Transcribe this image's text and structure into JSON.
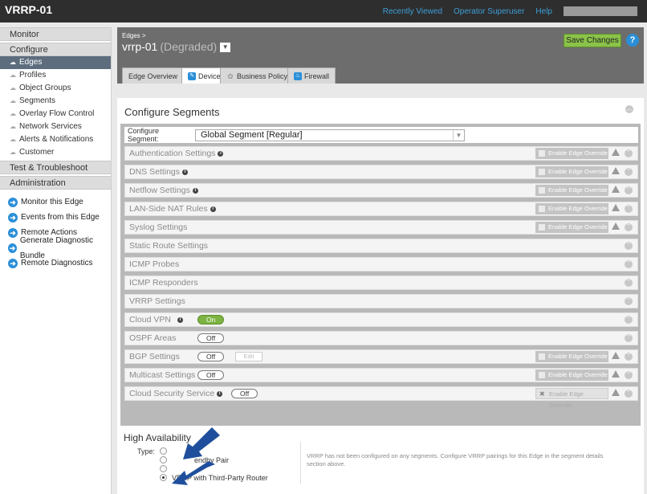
{
  "app": {
    "title": "VRRP-01",
    "links": [
      "Recently Viewed",
      "Operator Superuser",
      "Help"
    ]
  },
  "sidebar": {
    "monitor": "Monitor",
    "configure": "Configure",
    "config_items": [
      {
        "label": "Edges",
        "active": true
      },
      {
        "label": "Profiles"
      },
      {
        "label": "Object Groups"
      },
      {
        "label": "Segments"
      },
      {
        "label": "Overlay Flow Control"
      },
      {
        "label": "Network Services"
      },
      {
        "label": "Alerts & Notifications"
      },
      {
        "label": "Customer"
      }
    ],
    "test": "Test & Troubleshoot",
    "administration": "Administration",
    "actions": [
      "Monitor this Edge",
      "Events from this Edge",
      "Remote Actions",
      "Generate Diagnostic Bundle",
      "Remote Diagnostics"
    ]
  },
  "header": {
    "breadcrumb": "Edges",
    "edge_name": "vrrp-01",
    "status": "(Degraded)",
    "save_label": "Save Changes",
    "help_glyph": "?"
  },
  "tabs": [
    {
      "label": "Edge Overview"
    },
    {
      "label": "Device",
      "active": true
    },
    {
      "label": "Business Policy"
    },
    {
      "label": "Firewall"
    }
  ],
  "configure_segments": {
    "title": "Configure Segments",
    "segment_label": "Configure Segment:",
    "segment_value": "Global Segment [Regular]",
    "override_label": "Enable Edge Override",
    "sections": [
      {
        "label": "Authentication Settings",
        "info": true,
        "override": true
      },
      {
        "label": "DNS Settings",
        "info": true,
        "override": true
      },
      {
        "label": "Netflow Settings",
        "info": true,
        "override": true
      },
      {
        "label": "LAN-Side NAT Rules",
        "info": true,
        "override": true
      },
      {
        "label": "Syslog Settings",
        "override": true
      },
      {
        "label": "Static Route Settings"
      },
      {
        "label": "ICMP Probes"
      },
      {
        "label": "ICMP Responders"
      },
      {
        "label": "VRRP Settings"
      },
      {
        "label": "Cloud VPN",
        "info": true,
        "toggle": "On"
      },
      {
        "label": "OSPF Areas",
        "toggle": "Off"
      },
      {
        "label": "BGP Settings",
        "toggle": "Off",
        "edit": "Edit",
        "override": true
      },
      {
        "label": "Multicast Settings",
        "toggle": "Off",
        "override": true
      },
      {
        "label": "Cloud Security Service",
        "info": true,
        "toggle": "Off",
        "override_disabled": true
      }
    ]
  },
  "high_availability": {
    "title": "High Availability",
    "type_label": "Type:",
    "option_partial": "endby Pair",
    "selected_option": "VRRP with Third-Party Router",
    "note": "VRRP has not been configured on any segments. Configure VRRP pairings for this Edge in the segment details section above."
  },
  "colors": {
    "topbar": "#2e2e2e",
    "header": "#6d6d6d",
    "accent_blue": "#2a8fd8",
    "save_green": "#8bc34a",
    "callout_arrow": "#1f4f9c"
  }
}
